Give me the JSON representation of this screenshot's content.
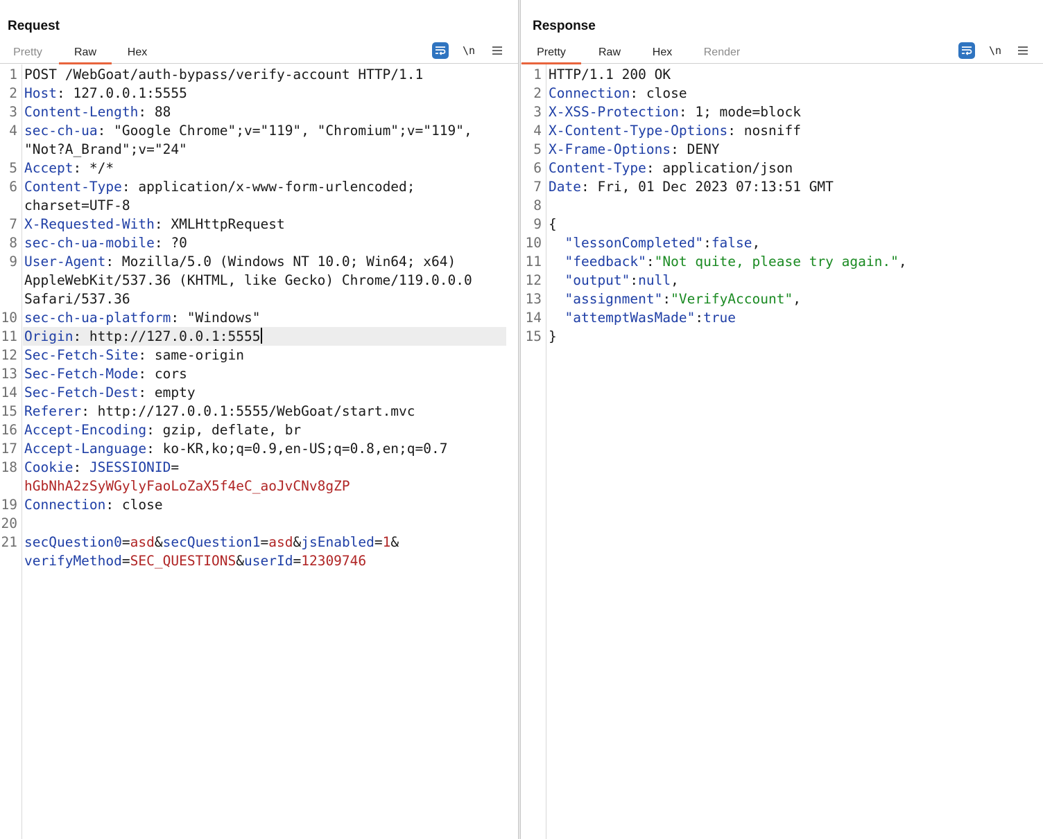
{
  "request": {
    "title": "Request",
    "tabs": [
      {
        "label": "Pretty",
        "state": "dim"
      },
      {
        "label": "Raw",
        "state": "active"
      },
      {
        "label": "Hex",
        "state": "normal"
      }
    ],
    "toolbar": {
      "newline_label": "\\n"
    },
    "lines": [
      {
        "n": "1",
        "segs": [
          {
            "t": "POST /WebGoat/auth-bypass/verify-account HTTP/1.1",
            "c": "v"
          }
        ]
      },
      {
        "n": "2",
        "segs": [
          {
            "t": "Host",
            "c": "k"
          },
          {
            "t": ": 127.0.0.1:5555",
            "c": "v"
          }
        ]
      },
      {
        "n": "3",
        "segs": [
          {
            "t": "Content-Length",
            "c": "k"
          },
          {
            "t": ": 88",
            "c": "v"
          }
        ]
      },
      {
        "n": "4",
        "segs": [
          {
            "t": "sec-ch-ua",
            "c": "k"
          },
          {
            "t": ": \"Google Chrome\";v=\"119\", \"Chromium\";v=\"119\",",
            "c": "v"
          }
        ]
      },
      {
        "n": "",
        "segs": [
          {
            "t": "\"Not?A_Brand\";v=\"24\"",
            "c": "v"
          }
        ]
      },
      {
        "n": "5",
        "segs": [
          {
            "t": "Accept",
            "c": "k"
          },
          {
            "t": ": */*",
            "c": "v"
          }
        ]
      },
      {
        "n": "6",
        "segs": [
          {
            "t": "Content-Type",
            "c": "k"
          },
          {
            "t": ": application/x-www-form-urlencoded;",
            "c": "v"
          }
        ]
      },
      {
        "n": "",
        "segs": [
          {
            "t": "charset=UTF-8",
            "c": "v"
          }
        ]
      },
      {
        "n": "7",
        "segs": [
          {
            "t": "X-Requested-With",
            "c": "k"
          },
          {
            "t": ": XMLHttpRequest",
            "c": "v"
          }
        ]
      },
      {
        "n": "8",
        "segs": [
          {
            "t": "sec-ch-ua-mobile",
            "c": "k"
          },
          {
            "t": ": ?0",
            "c": "v"
          }
        ]
      },
      {
        "n": "9",
        "segs": [
          {
            "t": "User-Agent",
            "c": "k"
          },
          {
            "t": ": Mozilla/5.0 (Windows NT 10.0; Win64; x64)",
            "c": "v"
          }
        ]
      },
      {
        "n": "",
        "segs": [
          {
            "t": "AppleWebKit/537.36 (KHTML, like Gecko) Chrome/119.0.0.0",
            "c": "v"
          }
        ]
      },
      {
        "n": "",
        "segs": [
          {
            "t": "Safari/537.36",
            "c": "v"
          }
        ]
      },
      {
        "n": "10",
        "segs": [
          {
            "t": "sec-ch-ua-platform",
            "c": "k"
          },
          {
            "t": ": \"Windows\"",
            "c": "v"
          }
        ]
      },
      {
        "n": "11",
        "segs": [
          {
            "t": "Origin",
            "c": "k"
          },
          {
            "t": ": http://127.0.0.1:5555",
            "c": "v"
          }
        ],
        "highlight": true,
        "caret": true
      },
      {
        "n": "12",
        "segs": [
          {
            "t": "Sec-Fetch-Site",
            "c": "k"
          },
          {
            "t": ": same-origin",
            "c": "v"
          }
        ]
      },
      {
        "n": "13",
        "segs": [
          {
            "t": "Sec-Fetch-Mode",
            "c": "k"
          },
          {
            "t": ": cors",
            "c": "v"
          }
        ]
      },
      {
        "n": "14",
        "segs": [
          {
            "t": "Sec-Fetch-Dest",
            "c": "k"
          },
          {
            "t": ": empty",
            "c": "v"
          }
        ]
      },
      {
        "n": "15",
        "segs": [
          {
            "t": "Referer",
            "c": "k"
          },
          {
            "t": ": http://127.0.0.1:5555/WebGoat/start.mvc",
            "c": "v"
          }
        ]
      },
      {
        "n": "16",
        "segs": [
          {
            "t": "Accept-Encoding",
            "c": "k"
          },
          {
            "t": ": gzip, deflate, br",
            "c": "v"
          }
        ]
      },
      {
        "n": "17",
        "segs": [
          {
            "t": "Accept-Language",
            "c": "k"
          },
          {
            "t": ": ko-KR,ko;q=0.9,en-US;q=0.8,en;q=0.7",
            "c": "v"
          }
        ]
      },
      {
        "n": "18",
        "segs": [
          {
            "t": "Cookie",
            "c": "k"
          },
          {
            "t": ": ",
            "c": "v"
          },
          {
            "t": "JSESSIONID",
            "c": "k"
          },
          {
            "t": "=",
            "c": "v"
          }
        ]
      },
      {
        "n": "",
        "segs": [
          {
            "t": "hGbNhA2zSyWGylyFaoLoZaX5f4eC_aoJvCNv8gZP",
            "c": "r"
          }
        ]
      },
      {
        "n": "19",
        "segs": [
          {
            "t": "Connection",
            "c": "k"
          },
          {
            "t": ": close",
            "c": "v"
          }
        ]
      },
      {
        "n": "20",
        "segs": []
      },
      {
        "n": "21",
        "segs": [
          {
            "t": "secQuestion0",
            "c": "k"
          },
          {
            "t": "=",
            "c": "v"
          },
          {
            "t": "asd",
            "c": "r"
          },
          {
            "t": "&",
            "c": "v"
          },
          {
            "t": "secQuestion1",
            "c": "k"
          },
          {
            "t": "=",
            "c": "v"
          },
          {
            "t": "asd",
            "c": "r"
          },
          {
            "t": "&",
            "c": "v"
          },
          {
            "t": "jsEnabled",
            "c": "k"
          },
          {
            "t": "=",
            "c": "v"
          },
          {
            "t": "1",
            "c": "r"
          },
          {
            "t": "&",
            "c": "v"
          }
        ]
      },
      {
        "n": "",
        "segs": [
          {
            "t": "verifyMethod",
            "c": "k"
          },
          {
            "t": "=",
            "c": "v"
          },
          {
            "t": "SEC_QUESTIONS",
            "c": "r"
          },
          {
            "t": "&",
            "c": "v"
          },
          {
            "t": "userId",
            "c": "k"
          },
          {
            "t": "=",
            "c": "v"
          },
          {
            "t": "12309746",
            "c": "r"
          }
        ]
      }
    ]
  },
  "response": {
    "title": "Response",
    "tabs": [
      {
        "label": "Pretty",
        "state": "active"
      },
      {
        "label": "Raw",
        "state": "normal"
      },
      {
        "label": "Hex",
        "state": "normal"
      },
      {
        "label": "Render",
        "state": "dim"
      }
    ],
    "toolbar": {
      "newline_label": "\\n"
    },
    "lines": [
      {
        "n": "1",
        "segs": [
          {
            "t": "HTTP/1.1 200 OK",
            "c": "v"
          }
        ]
      },
      {
        "n": "2",
        "segs": [
          {
            "t": "Connection",
            "c": "k"
          },
          {
            "t": ": close",
            "c": "v"
          }
        ]
      },
      {
        "n": "3",
        "segs": [
          {
            "t": "X-XSS-Protection",
            "c": "k"
          },
          {
            "t": ": 1; mode=block",
            "c": "v"
          }
        ]
      },
      {
        "n": "4",
        "segs": [
          {
            "t": "X-Content-Type-Options",
            "c": "k"
          },
          {
            "t": ": nosniff",
            "c": "v"
          }
        ]
      },
      {
        "n": "5",
        "segs": [
          {
            "t": "X-Frame-Options",
            "c": "k"
          },
          {
            "t": ": DENY",
            "c": "v"
          }
        ]
      },
      {
        "n": "6",
        "segs": [
          {
            "t": "Content-Type",
            "c": "k"
          },
          {
            "t": ": application/json",
            "c": "v"
          }
        ]
      },
      {
        "n": "7",
        "segs": [
          {
            "t": "Date",
            "c": "k"
          },
          {
            "t": ": Fri, 01 Dec 2023 07:13:51 GMT",
            "c": "v"
          }
        ]
      },
      {
        "n": "8",
        "segs": []
      },
      {
        "n": "9",
        "segs": [
          {
            "t": "{",
            "c": "v"
          }
        ]
      },
      {
        "n": "10",
        "segs": [
          {
            "t": "  \"lessonCompleted\"",
            "c": "jk"
          },
          {
            "t": ":",
            "c": "v"
          },
          {
            "t": "false",
            "c": "jk"
          },
          {
            "t": ",",
            "c": "v"
          }
        ]
      },
      {
        "n": "11",
        "segs": [
          {
            "t": "  \"feedback\"",
            "c": "jk"
          },
          {
            "t": ":",
            "c": "v"
          },
          {
            "t": "\"Not quite, please try again.\"",
            "c": "g"
          },
          {
            "t": ",",
            "c": "v"
          }
        ]
      },
      {
        "n": "12",
        "segs": [
          {
            "t": "  \"output\"",
            "c": "jk"
          },
          {
            "t": ":",
            "c": "v"
          },
          {
            "t": "null",
            "c": "jk"
          },
          {
            "t": ",",
            "c": "v"
          }
        ]
      },
      {
        "n": "13",
        "segs": [
          {
            "t": "  \"assignment\"",
            "c": "jk"
          },
          {
            "t": ":",
            "c": "v"
          },
          {
            "t": "\"VerifyAccount\"",
            "c": "g"
          },
          {
            "t": ",",
            "c": "v"
          }
        ]
      },
      {
        "n": "14",
        "segs": [
          {
            "t": "  \"attemptWasMade\"",
            "c": "jk"
          },
          {
            "t": ":",
            "c": "v"
          },
          {
            "t": "true",
            "c": "jk"
          }
        ]
      },
      {
        "n": "15",
        "segs": [
          {
            "t": "}",
            "c": "v"
          }
        ]
      }
    ]
  },
  "layout_controls": [
    {
      "icon": "split-horizontal-icon",
      "state": "active"
    },
    {
      "icon": "split-vertical-icon",
      "state": "normal"
    },
    {
      "icon": "single-pane-icon",
      "state": "normal"
    }
  ],
  "colors": {
    "accent": "#e8643c",
    "button_blue": "#2f74c0",
    "header_key": "#1f3fa6",
    "param_value": "#b02525",
    "json_string": "#1a8a22"
  }
}
